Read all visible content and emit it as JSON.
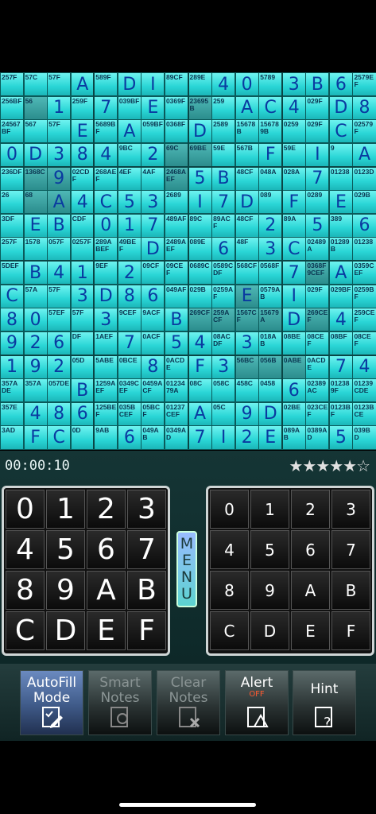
{
  "board": {
    "size": 16,
    "rows": [
      [
        "n:257F",
        "n:57C",
        "n:57F",
        "b:A",
        "n:589F",
        "b:D",
        "b:I",
        "n:89CF",
        "n:289E",
        "b:4",
        "b:0",
        "n:5789",
        "b:3",
        "b:B",
        "b:6",
        "n:2579EF"
      ],
      [
        "n:256BF",
        "n:56",
        "b:1",
        "n:259F",
        "b:7",
        "n:039BF",
        "b:E",
        "n:0369F",
        "n:23695B",
        "n:259",
        "b:A",
        "b:C",
        "b:4",
        "n:029F",
        "b:D",
        "b:8"
      ],
      [
        "n:24567BF",
        "n:567",
        "n:57F",
        "b:E",
        "n:5689BF",
        "b:A",
        "n:059BF",
        "n:0368F",
        "b:D",
        "n:2589",
        "n:15678B",
        "n:156789B",
        "n:0259",
        "n:029F",
        "b:C",
        "n:02579F"
      ],
      [
        "b:0",
        "b:D",
        "b:3",
        "b:8",
        "b:4",
        "n:9BC",
        "b:2",
        "n:69C",
        "n:69BE",
        "n:59E",
        "n:567B",
        "b:F",
        "n:59E",
        "b:I",
        "n:9",
        "b:A"
      ],
      [
        "n:236DF",
        "n:1368C",
        "b:9",
        "n:02CDF",
        "n:268AEF",
        "n:4EF",
        "n:4AF",
        "n:2468AEF",
        "b:5",
        "b:B",
        "n:48CF",
        "n:048A",
        "n:028A",
        "b:7",
        "n:01238",
        "n:0123D"
      ],
      [
        "n:26",
        "n:68",
        "b:A",
        "b:4",
        "b:C",
        "b:5",
        "b:3",
        "n:2689",
        "b:I",
        "b:7",
        "b:D",
        "n:089",
        "b:F",
        "n:0289",
        "b:E",
        "n:029B"
      ],
      [
        "n:3DF",
        "b:E",
        "b:B",
        "n:CDF",
        "b:0",
        "b:1",
        "b:7",
        "n:489AF",
        "n:89C",
        "n:89ACF",
        "n:48CF",
        "b:2",
        "n:89A",
        "b:5",
        "n:389",
        "b:6"
      ],
      [
        "n:257F",
        "n:1578",
        "n:057F",
        "n:0257F",
        "n:289ABEF",
        "n:49BEF",
        "b:D",
        "n:2489AEF",
        "n:089E",
        "b:6",
        "n:48F",
        "b:3",
        "b:C",
        "n:02489A",
        "n:01289B",
        "n:01238"
      ],
      [
        "n:5DEF",
        "b:B",
        "b:4",
        "b:1",
        "n:9EF",
        "b:2",
        "n:09CF",
        "n:09CEF",
        "n:0689C",
        "n:0589CDF",
        "n:568CF",
        "n:0568F",
        "b:7",
        "n:0368F9CEF",
        "b:A",
        "n:0359CEF"
      ],
      [
        "b:C",
        "n:57A",
        "n:57F",
        "b:3",
        "b:D",
        "b:8",
        "b:6",
        "n:049AF",
        "n:029B",
        "n:0259AF",
        "b:E",
        "n:0579AB",
        "b:I",
        "n:029F",
        "n:029BF",
        "n:0259BF"
      ],
      [
        "b:8",
        "b:0",
        "n:57EF",
        "n:57F",
        "b:3",
        "n:9CEF",
        "n:9ACF",
        "b:B",
        "n:269CF",
        "n:259ACF",
        "n:1567CF",
        "n:15679A",
        "b:D",
        "n:269CEF",
        "b:4",
        "n:259CEF"
      ],
      [
        "b:9",
        "b:2",
        "b:6",
        "n:DF",
        "n:1AEF",
        "b:7",
        "n:0ACF",
        "b:5",
        "b:4",
        "n:08ACDF",
        "b:3",
        "n:018AB",
        "n:08BE",
        "n:08CEF",
        "n:08BF",
        "n:08CEF"
      ],
      [
        "b:1",
        "b:9",
        "b:2",
        "n:05D",
        "n:5ABE",
        "n:0BCE",
        "b:8",
        "n:0ACDE",
        "b:F",
        "b:3",
        "n:56BC",
        "n:056B",
        "n:0ABE",
        "n:0ACDE",
        "b:7",
        "b:4"
      ],
      [
        "n:357ADE",
        "n:357A",
        "n:057DE",
        "b:B",
        "n:1259AEF",
        "n:0349CEF",
        "n:0459ACF",
        "n:01234 79A",
        "n:08C",
        "n:058C",
        "n:458C",
        "n:0458",
        "b:6",
        "n:02389AC",
        "n:012389F",
        "n:01239CDE"
      ],
      [
        "n:357E",
        "b:4",
        "b:8",
        "b:6",
        "n:125BEF",
        "n:035BCEF",
        "n:05BCF",
        "n:01237CEF",
        "b:A",
        "n:05C",
        "b:9",
        "b:D",
        "n:02BE",
        "n:023CEF",
        "n:0123BF",
        "n:0123BCE"
      ],
      [
        "n:3AD",
        "b:F",
        "b:C",
        "n:0D",
        "n:9AB",
        "b:6",
        "n:049AB",
        "n:0349AD",
        "b:7",
        "b:I",
        "b:2",
        "b:E",
        "n:089AB",
        "n:0389AD",
        "b:5",
        "n:039BD"
      ]
    ],
    "dark_cells": [
      [
        1,
        1
      ],
      [
        1,
        8
      ],
      [
        3,
        8
      ],
      [
        4,
        1
      ],
      [
        4,
        2
      ],
      [
        5,
        1
      ],
      [
        5,
        2
      ],
      [
        3,
        7
      ],
      [
        4,
        7
      ],
      [
        9,
        10
      ],
      [
        10,
        8
      ],
      [
        10,
        9
      ],
      [
        10,
        10
      ],
      [
        10,
        11
      ],
      [
        12,
        10
      ],
      [
        12,
        11
      ],
      [
        8,
        13
      ],
      [
        10,
        13
      ],
      [
        12,
        12
      ]
    ]
  },
  "status": {
    "timer": "00:00:10",
    "rating": "★★★★★☆",
    "rating_value": 5,
    "rating_max": 6
  },
  "left_pad": [
    "0",
    "1",
    "2",
    "3",
    "4",
    "5",
    "6",
    "7",
    "8",
    "9",
    "A",
    "B",
    "C",
    "D",
    "E",
    "F"
  ],
  "right_pad": [
    "0",
    "1",
    "2",
    "3",
    "4",
    "5",
    "6",
    "7",
    "8",
    "9",
    "A",
    "B",
    "C",
    "D",
    "E",
    "F"
  ],
  "menu": {
    "label": "MENU"
  },
  "toolbar": {
    "autofill": {
      "label1": "AutoFill",
      "label2": "Mode"
    },
    "smart": {
      "label1": "Smart",
      "label2": "Notes"
    },
    "clear": {
      "label1": "Clear",
      "label2": "Notes"
    },
    "alert": {
      "label1": "Alert",
      "sub": "OFF"
    },
    "hint": {
      "label1": "Hint"
    }
  }
}
